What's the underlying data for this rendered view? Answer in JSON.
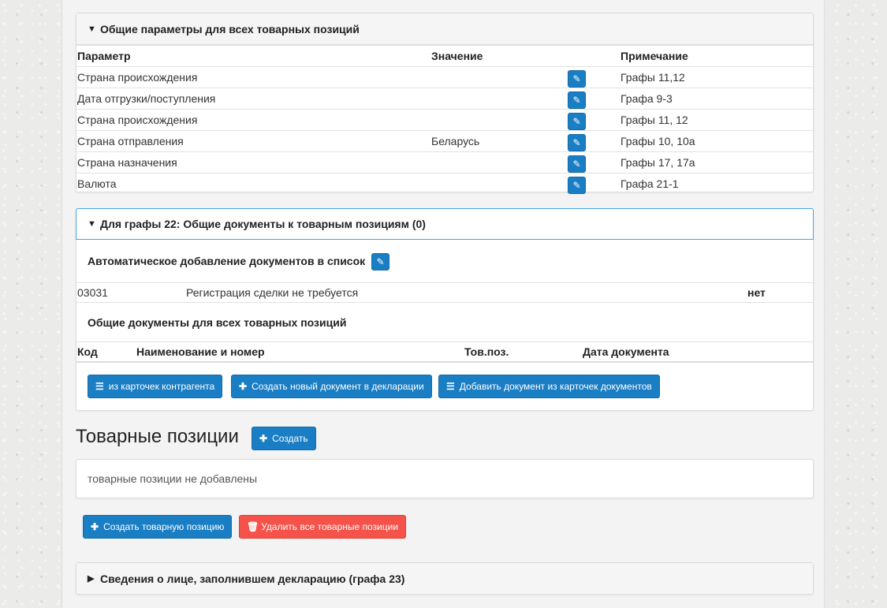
{
  "general_params": {
    "title": "Общие параметры для всех товарных позиций",
    "columns": {
      "param": "Параметр",
      "value": "Значение",
      "note": "Примечание"
    },
    "rows": [
      {
        "param": "Страна происхождения",
        "value": "",
        "note": "Графы 11,12"
      },
      {
        "param": "Дата отгрузки/поступления",
        "value": "",
        "note": "Графа 9-3"
      },
      {
        "param": "Страна происхождения",
        "value": "",
        "note": "Графы 11, 12"
      },
      {
        "param": "Страна отправления",
        "value": "Беларусь",
        "note": "Графы 10, 10а"
      },
      {
        "param": "Страна назначения",
        "value": "",
        "note": "Графы 17, 17а"
      },
      {
        "param": "Валюта",
        "value": "",
        "note": "Графа 21-1"
      }
    ]
  },
  "docs22": {
    "title": "Для графы 22: Общие документы к товарным позициям (0)",
    "auto_add_label": "Автоматическое добавление документов в список",
    "auto_row": {
      "code": "03031",
      "name": "Регистрация сделки не требуется",
      "flag": "нет"
    },
    "common_docs_title": "Общие документы для всех товарных позиций",
    "columns": {
      "code": "Код",
      "name": "Наименование и номер",
      "pos": "Тов.поз.",
      "date": "Дата документа"
    },
    "buttons": {
      "from_contractor": "из карточек контрагента",
      "create_new": "Создать новый документ в декларации",
      "add_from_cards": "Добавить документ из карточек документов"
    }
  },
  "items": {
    "title": "Товарные позиции",
    "create_label": "Создать",
    "empty_text": "товарные позиции не добавлены",
    "create_item_label": "Создать товарную позицию",
    "delete_all_label": "Удалить все товарные позиции"
  },
  "declarant": {
    "title": "Сведения о лице, заполнившем декларацию (графа 23)"
  },
  "colors": {
    "primary": "#1a7ec4",
    "danger": "#f5524a",
    "active_border": "#42a5f5"
  }
}
